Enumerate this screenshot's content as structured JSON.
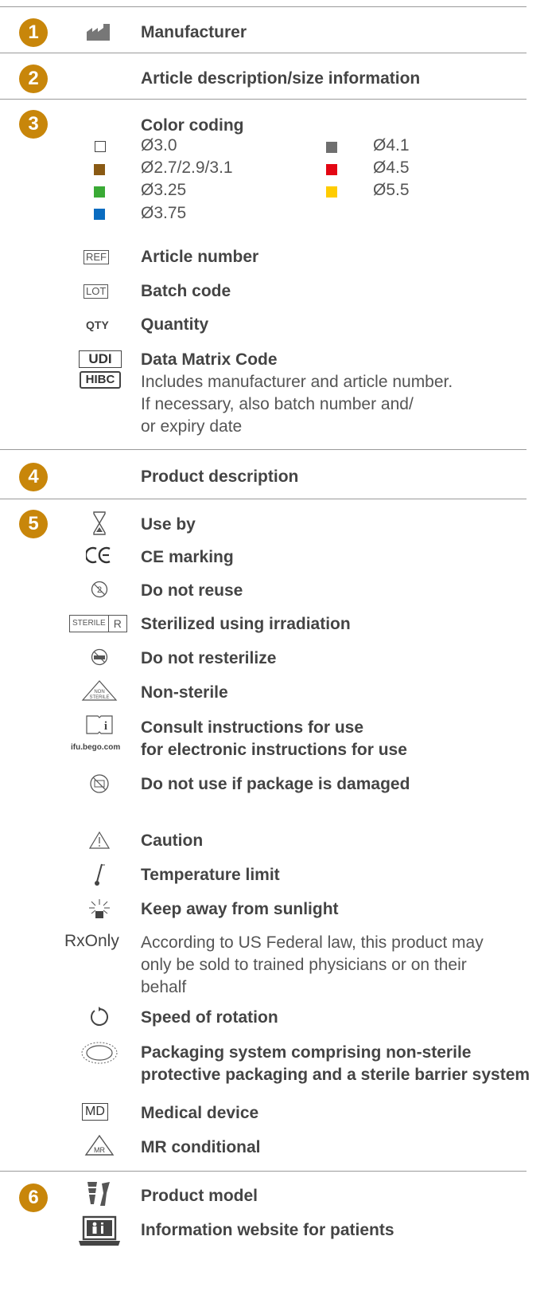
{
  "sections": [
    {
      "number": "1",
      "title": "Manufacturer"
    },
    {
      "number": "2",
      "title": "Article description/size information"
    },
    {
      "number": "3",
      "title": "Color coding"
    },
    {
      "number": "4",
      "title": "Product description"
    },
    {
      "number": "5",
      "title": "Use by"
    },
    {
      "number": "6",
      "title": "Product model"
    }
  ],
  "colors": {
    "accent": "#c8860a",
    "white_swatch": "#ffffff",
    "brown": "#8a5a14",
    "green": "#3aaa35",
    "blue": "#0a6cc0",
    "gray": "#6f6f6f",
    "red": "#e30613",
    "yellow": "#ffcc00"
  },
  "color_coding": {
    "left": [
      "Ø3.0",
      "Ø2.7/2.9/3.1",
      "Ø3.25",
      "Ø3.75"
    ],
    "right": [
      "Ø4.1",
      "Ø4.5",
      "Ø5.5"
    ]
  },
  "sec3_items": {
    "ref_icon": "REF",
    "ref": "Article number",
    "lot_icon": "LOT",
    "lot": "Batch code",
    "qty_icon": "QTY",
    "qty": "Quantity",
    "udi_icon": "UDI",
    "hibc_icon": "HIBC",
    "udi": "Data Matrix Code",
    "udi_desc": [
      "Includes manufacturer and article number.",
      "If necessary, also batch number and/",
      "or expiry date"
    ]
  },
  "sec5_items": {
    "ce": "CE marking",
    "reuse": "Do not reuse",
    "sterile_icon": "STERILE",
    "sterile_r": "R",
    "sterile": "Sterilized using irradiation",
    "resterilize": "Do not resterilize",
    "nonsterile_icon": "NON STERILE",
    "nonsterile": "Non-sterile",
    "consult": "Consult instructions for use",
    "ifu_icon": "ifu.bego.com",
    "ifu": "for electronic instructions for use",
    "damaged": "Do not use if package is damaged",
    "caution": "Caution",
    "temp": "Temperature limit",
    "sun": "Keep away from sunlight",
    "rx_icon": "RxOnly",
    "rx_desc": [
      "According to US Federal law, this product may",
      "only be sold to trained physicians or on their",
      "behalf"
    ],
    "rotation": "Speed of rotation",
    "packaging": [
      "Packaging system comprising non-sterile",
      "protective packaging and a sterile barrier system"
    ],
    "md_icon": "MD",
    "md": "Medical device",
    "mr_icon": "MR",
    "mr": "MR conditional"
  },
  "sec6_items": {
    "website": "Information website for patients"
  }
}
